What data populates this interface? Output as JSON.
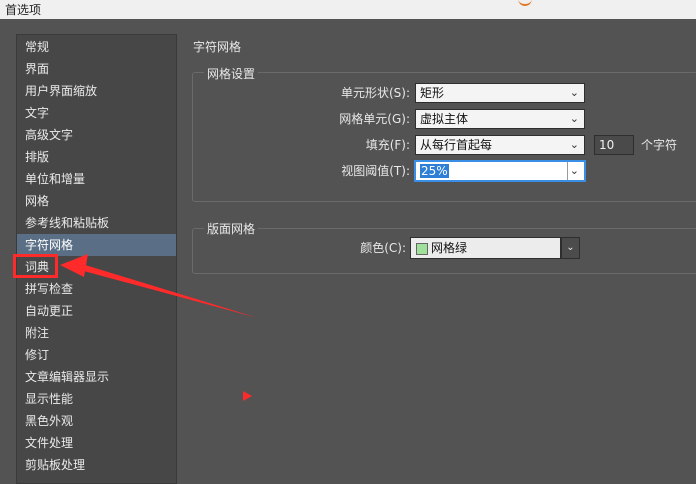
{
  "window": {
    "title": "首选项"
  },
  "colors": {
    "accent": "#5a6f86",
    "annotation": "#ff2a2a",
    "swatch": "#9fe09a"
  },
  "sidebar": {
    "items": [
      {
        "label": "常规"
      },
      {
        "label": "界面"
      },
      {
        "label": "用户界面缩放"
      },
      {
        "label": "文字"
      },
      {
        "label": "高级文字"
      },
      {
        "label": "排版"
      },
      {
        "label": "单位和增量"
      },
      {
        "label": "网格"
      },
      {
        "label": "参考线和粘贴板"
      },
      {
        "label": "字符网格"
      },
      {
        "label": "词典"
      },
      {
        "label": "拼写检查"
      },
      {
        "label": "自动更正"
      },
      {
        "label": "附注"
      },
      {
        "label": "修订"
      },
      {
        "label": "文章编辑器显示"
      },
      {
        "label": "显示性能"
      },
      {
        "label": "黑色外观"
      },
      {
        "label": "文件处理"
      },
      {
        "label": "剪贴板处理"
      }
    ],
    "selected_index": 9,
    "highlighted_index": 10
  },
  "main": {
    "section_title": "字符网格",
    "grid_settings": {
      "legend": "网格设置",
      "cell_shape": {
        "label": "单元形状(S):",
        "value": "矩形"
      },
      "grid_unit": {
        "label": "网格单元(G):",
        "value": "虚拟主体"
      },
      "fill": {
        "label": "填充(F):",
        "value": "从每行首起每",
        "count": "10",
        "unit": "个字符"
      },
      "view_threshold": {
        "label": "视图阈值(T):",
        "value": "25%"
      }
    },
    "layout_grid": {
      "legend": "版面网格",
      "color": {
        "label": "颜色(C):",
        "value": "网格绿"
      }
    }
  }
}
